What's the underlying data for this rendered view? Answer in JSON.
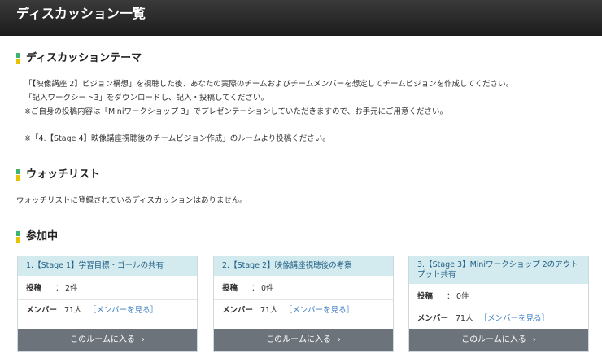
{
  "header": {
    "title": "ディスカッション一覧"
  },
  "theme_section": {
    "heading": "ディスカッションテーマ",
    "lines": [
      "「【映像講座 2】ビジョン構想」を視聴した後、あなたの実際のチームおよびチームメンバーを想定してチームビジョンを作成してください。",
      "「記入ワークシート3」をダウンロードし、記入・投稿してください。",
      "※ご自身の投稿内容は「Miniワークショップ 3」でプレゼンテーションしていただきますので、お手元にご用意ください。",
      "※「4.【Stage 4】映像講座視聴後のチームビジョン作成」のルームより投稿ください。"
    ]
  },
  "watchlist_section": {
    "heading": "ウォッチリスト",
    "empty_text": "ウォッチリストに登録されているディスカッションはありません。"
  },
  "joined_section": {
    "heading": "参加中",
    "cards": [
      {
        "title": "1.【Stage 1】学習目標・ゴールの共有",
        "posts_label": "投稿",
        "posts_value": "2件",
        "members_label": "メンバー",
        "members_value": "71人",
        "members_link": "［メンバーを見る］",
        "enter_label": "このルームに入る"
      },
      {
        "title": "2.【Stage 2】映像講座視聴後の考察",
        "posts_label": "投稿",
        "posts_value": "0件",
        "members_label": "メンバー",
        "members_value": "71人",
        "members_link": "［メンバーを見る］",
        "enter_label": "このルームに入る"
      },
      {
        "title": "3.【Stage 3】Miniワークショップ 2のアウトプット共有",
        "posts_label": "投稿",
        "posts_value": "0件",
        "members_label": "メンバー",
        "members_value": "71人",
        "members_link": "［メンバーを見る］",
        "enter_label": "このルームに入る"
      }
    ]
  },
  "colors": {
    "accent_green": "#3cb371",
    "accent_yellow": "#e6c200",
    "card_header": "#d3eaee",
    "link": "#3d7fc1",
    "button": "#6c737a"
  },
  "icons": {
    "enter": "chevron-right-icon"
  }
}
